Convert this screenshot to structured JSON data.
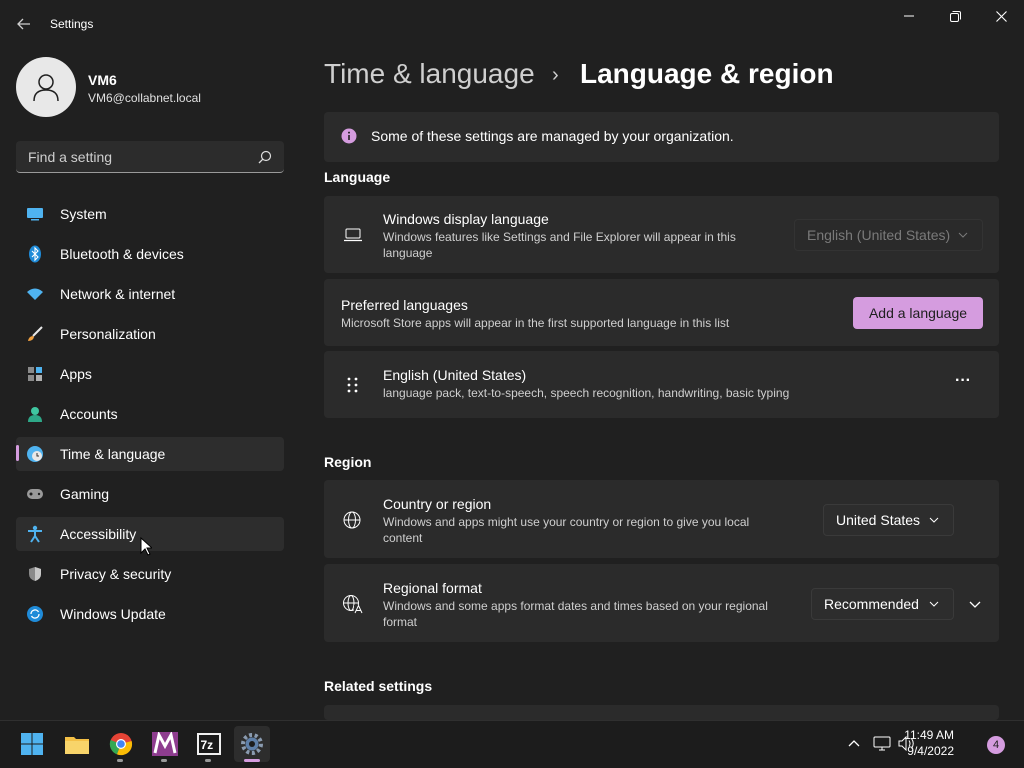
{
  "window": {
    "title": "Settings",
    "accent_color": "#d59cdf"
  },
  "profile": {
    "name": "VM6",
    "email": "VM6@collabnet.local"
  },
  "search": {
    "placeholder": "Find a setting"
  },
  "nav": {
    "items": [
      {
        "label": "System",
        "icon": "monitor-icon"
      },
      {
        "label": "Bluetooth & devices",
        "icon": "bluetooth-icon"
      },
      {
        "label": "Network & internet",
        "icon": "wifi-icon"
      },
      {
        "label": "Personalization",
        "icon": "brush-icon"
      },
      {
        "label": "Apps",
        "icon": "apps-icon"
      },
      {
        "label": "Accounts",
        "icon": "person-icon"
      },
      {
        "label": "Time & language",
        "icon": "globe-clock-icon",
        "active": true
      },
      {
        "label": "Gaming",
        "icon": "gamepad-icon"
      },
      {
        "label": "Accessibility",
        "icon": "accessibility-icon"
      },
      {
        "label": "Privacy & security",
        "icon": "shield-icon"
      },
      {
        "label": "Windows Update",
        "icon": "update-icon"
      }
    ]
  },
  "breadcrumb": {
    "parent": "Time & language",
    "separator": "›",
    "current": "Language & region"
  },
  "info_bar": {
    "text": "Some of these settings are managed by your organization."
  },
  "language": {
    "heading": "Language",
    "display_language": {
      "title": "Windows display language",
      "desc": "Windows features like Settings and File Explorer will appear in this language",
      "value": "English (United States)"
    },
    "preferred": {
      "title": "Preferred languages",
      "desc": "Microsoft Store apps will appear in the first supported language in this list",
      "button": "Add a language"
    },
    "entry": {
      "title": "English (United States)",
      "desc": "language pack, text-to-speech, speech recognition, handwriting, basic typing",
      "more": "···"
    }
  },
  "region": {
    "heading": "Region",
    "country": {
      "title": "Country or region",
      "desc": "Windows and apps might use your country or region to give you local content",
      "value": "United States"
    },
    "format": {
      "title": "Regional format",
      "desc": "Windows and some apps format dates and times based on your regional format",
      "value": "Recommended"
    }
  },
  "related": {
    "heading": "Related settings"
  },
  "taskbar": {
    "apps": [
      "start-icon",
      "file-explorer-icon",
      "chrome-icon",
      "m-app-icon",
      "7zip-icon",
      "settings-gear-icon"
    ],
    "time": "11:49 AM",
    "date": "9/4/2022",
    "notifications": "4"
  }
}
